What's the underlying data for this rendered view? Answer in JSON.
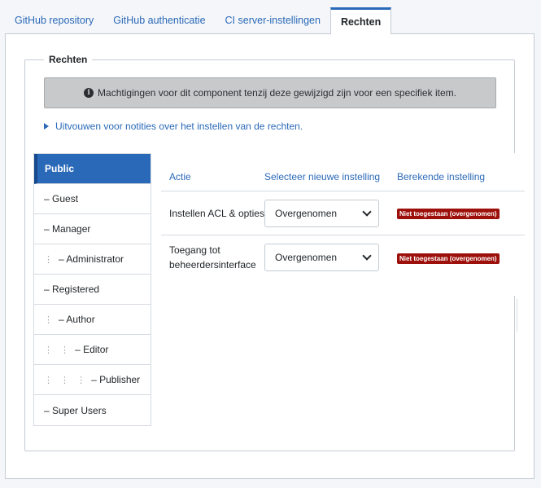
{
  "tabs": [
    {
      "label": "GitHub repository"
    },
    {
      "label": "GitHub authenticatie"
    },
    {
      "label": "CI server-instellingen"
    },
    {
      "label": "Rechten"
    }
  ],
  "fieldset": {
    "legend": "Rechten",
    "alert": "Machtigingen voor dit component tenzij deze gewijzigd zijn voor een specifiek item.",
    "expander": "Uitvouwen voor notities over het instellen van de rechten."
  },
  "groups": [
    {
      "label": "Public",
      "dots": ""
    },
    {
      "label": "– Guest",
      "dots": ""
    },
    {
      "label": "– Manager",
      "dots": ""
    },
    {
      "label": "– Administrator",
      "dots": "⋮"
    },
    {
      "label": "– Registered",
      "dots": ""
    },
    {
      "label": "– Author",
      "dots": "⋮"
    },
    {
      "label": "– Editor",
      "dots": "⋮ ⋮"
    },
    {
      "label": "– Publisher",
      "dots": "⋮ ⋮ ⋮"
    },
    {
      "label": "– Super Users",
      "dots": ""
    }
  ],
  "table": {
    "headers": {
      "action": "Actie",
      "select": "Selecteer nieuwe instelling",
      "computed": "Berekende instelling"
    },
    "rows": [
      {
        "action": "Instellen ACL & opties",
        "value": "Overgenomen",
        "computed": "Niet toegestaan (overgenomen)"
      },
      {
        "action": "Toegang tot beheerdersinterface",
        "value": "Overgenomen",
        "computed": "Niet toegestaan (overgenomen)"
      }
    ]
  },
  "colors": {
    "accent": "#2a69b8",
    "badge": "#9c0f0a"
  }
}
